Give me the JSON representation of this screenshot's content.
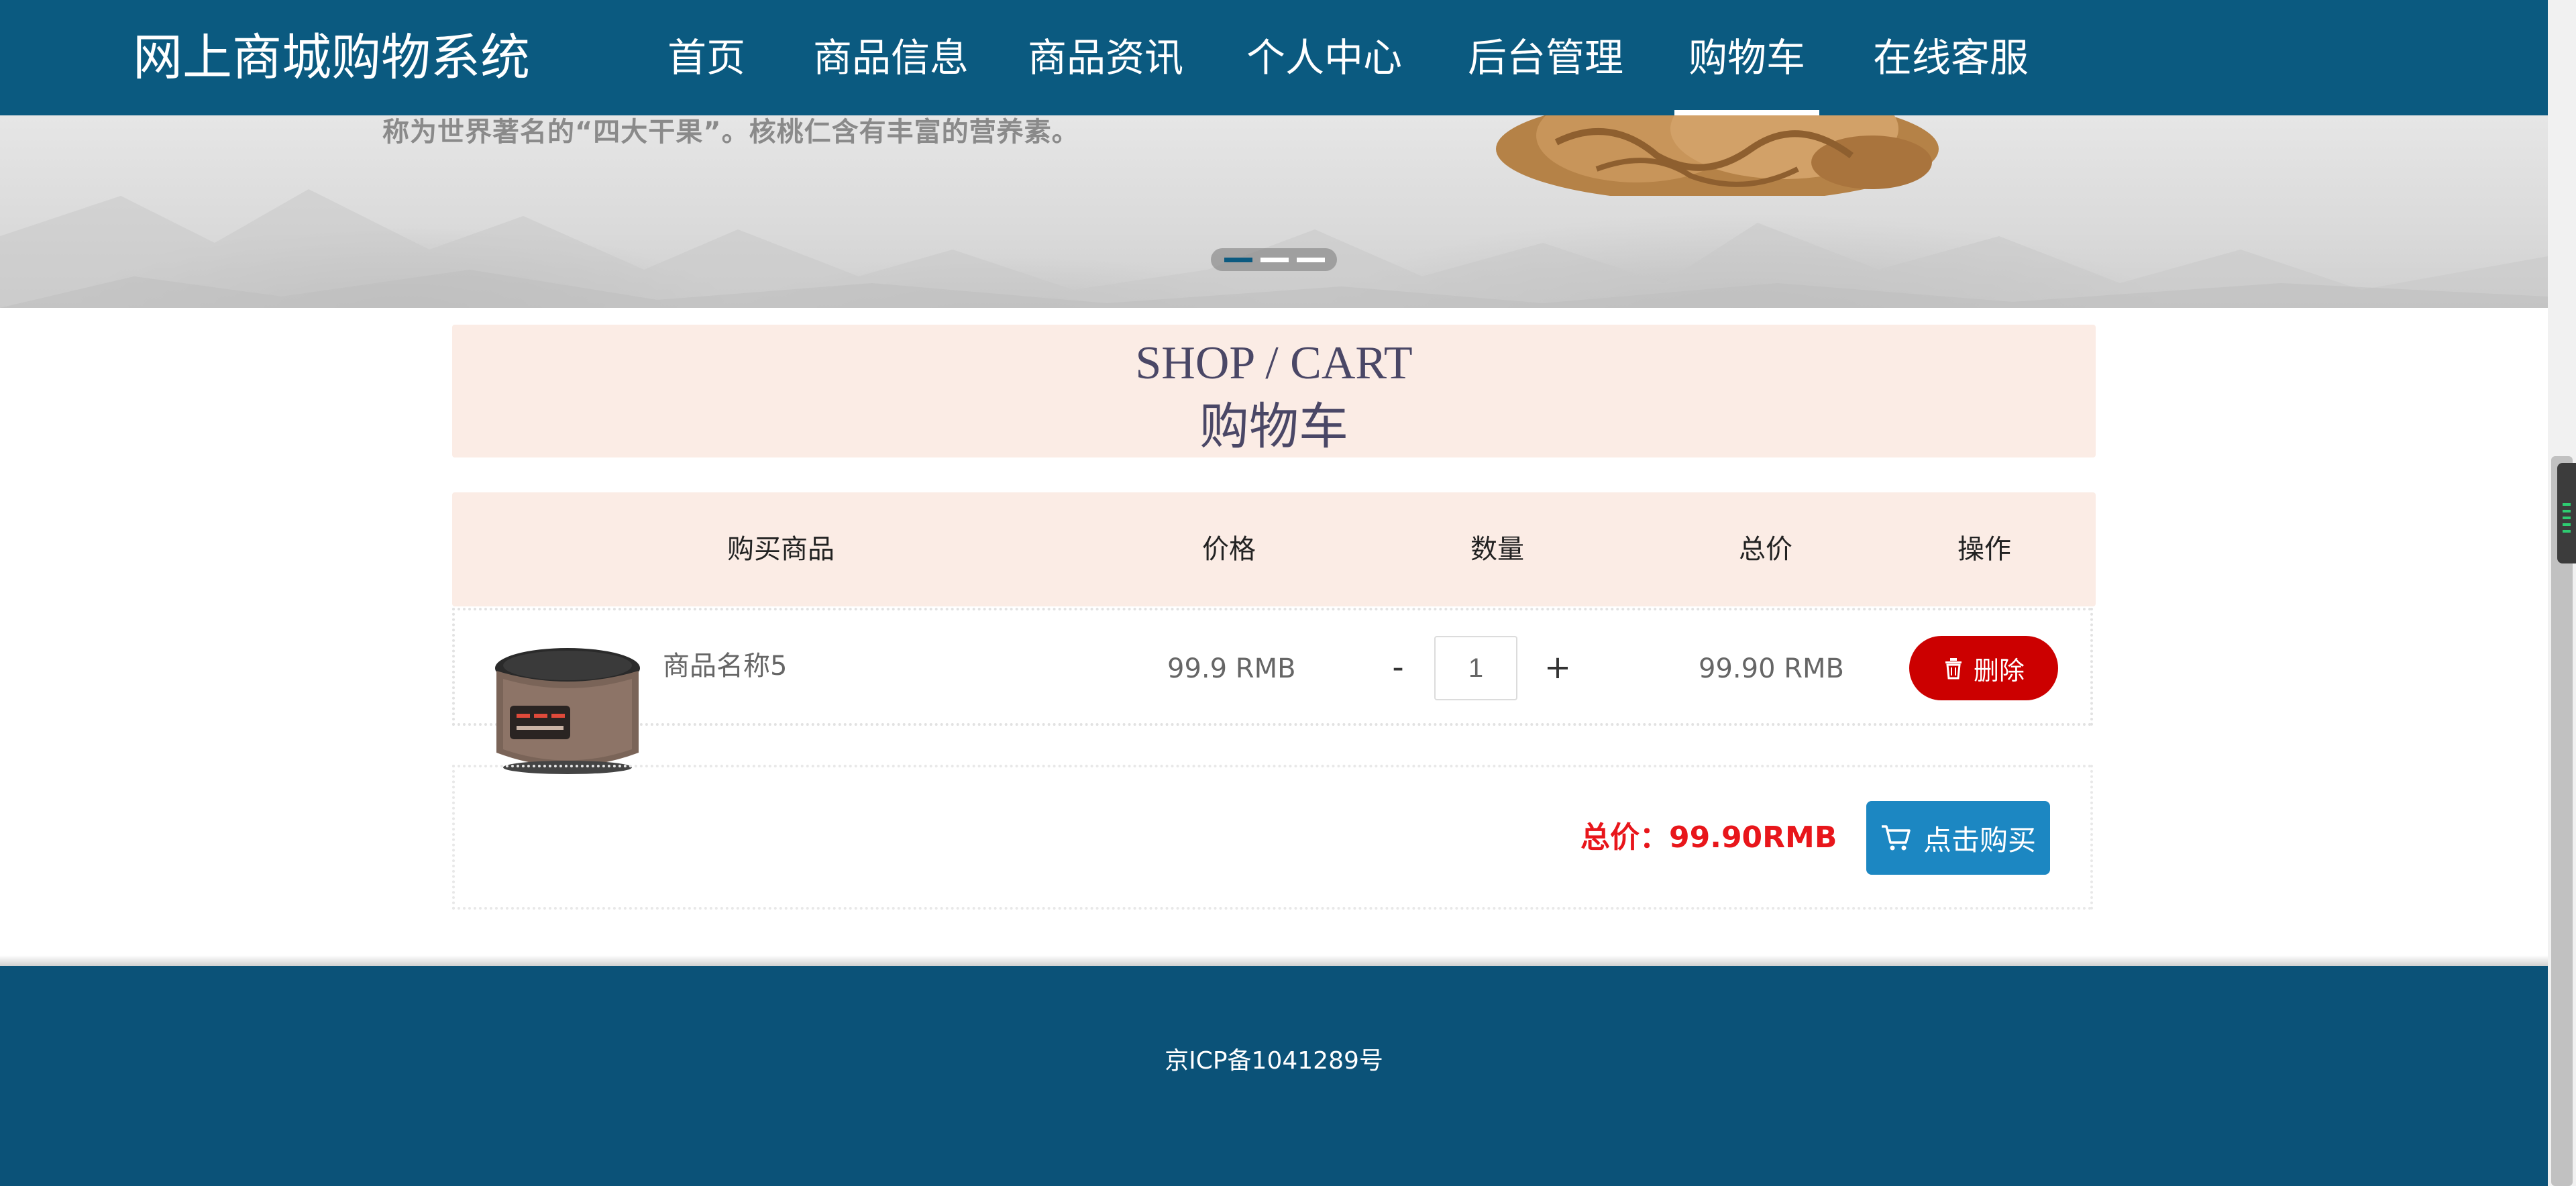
{
  "header": {
    "site_title": "网上商城购物系统",
    "nav": [
      {
        "label": "首页",
        "active": false
      },
      {
        "label": "商品信息",
        "active": false
      },
      {
        "label": "商品资讯",
        "active": false
      },
      {
        "label": "个人中心",
        "active": false
      },
      {
        "label": "后台管理",
        "active": false
      },
      {
        "label": "购物车",
        "active": true
      },
      {
        "label": "在线客服",
        "active": false
      }
    ]
  },
  "banner": {
    "caption": "称为世界著名的“四大干果”。核桃仁含有丰富的营养素。",
    "slides_total": 3,
    "active_slide": 1
  },
  "section": {
    "title_en": "SHOP / CART",
    "title_zh": "购物车"
  },
  "cart": {
    "columns": {
      "product": "购买商品",
      "price": "价格",
      "quantity": "数量",
      "subtotal": "总价",
      "action": "操作"
    },
    "items": [
      {
        "name": "商品名称5",
        "image_icon": "rice-cooker-image",
        "price": "99.9 RMB",
        "quantity": "1",
        "minus": "-",
        "plus": "+",
        "subtotal": "99.90 RMB",
        "delete_label": "删除",
        "delete_icon": "trash-icon"
      }
    ],
    "total_label": "总价：99.90RMB",
    "buy_label": "点击购买",
    "buy_icon": "cart-icon"
  },
  "footer": {
    "icp": "京ICP备1041289号"
  },
  "colors": {
    "header_bg": "#0b5a80",
    "footer_bg": "#0b5278",
    "section_bg": "#fbece5",
    "delete_button": "#cc0000",
    "buy_button": "#1c87c2",
    "total_text": "#e8161b"
  }
}
